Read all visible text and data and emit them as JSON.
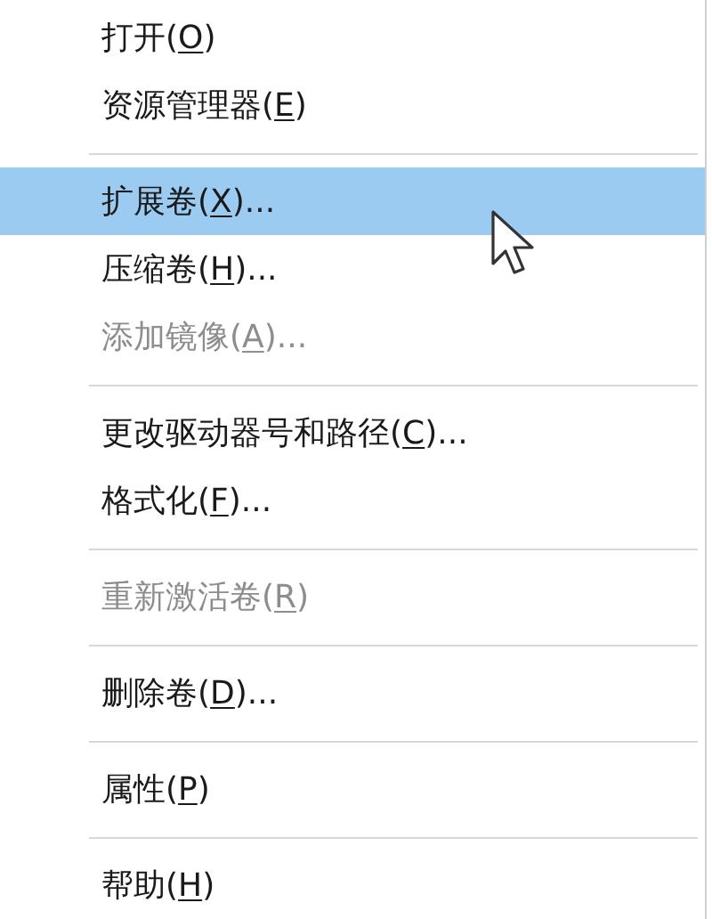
{
  "menu": {
    "items": [
      {
        "kind": "item",
        "before": "打开(",
        "key": "O",
        "after": ")",
        "selected": false,
        "disabled": false
      },
      {
        "kind": "item",
        "before": "资源管理器(",
        "key": "E",
        "after": ")",
        "selected": false,
        "disabled": false
      },
      {
        "kind": "separator"
      },
      {
        "kind": "item",
        "before": "扩展卷(",
        "key": "X",
        "after": ")...",
        "selected": true,
        "disabled": false
      },
      {
        "kind": "item",
        "before": "压缩卷(",
        "key": "H",
        "after": ")...",
        "selected": false,
        "disabled": false
      },
      {
        "kind": "item",
        "before": "添加镜像(",
        "key": "A",
        "after": ")...",
        "selected": false,
        "disabled": true
      },
      {
        "kind": "separator"
      },
      {
        "kind": "item",
        "before": "更改驱动器号和路径(",
        "key": "C",
        "after": ")...",
        "selected": false,
        "disabled": false
      },
      {
        "kind": "item",
        "before": "格式化(",
        "key": "F",
        "after": ")...",
        "selected": false,
        "disabled": false
      },
      {
        "kind": "separator"
      },
      {
        "kind": "item",
        "before": "重新激活卷(",
        "key": "R",
        "after": ")",
        "selected": false,
        "disabled": true
      },
      {
        "kind": "separator"
      },
      {
        "kind": "item",
        "before": "删除卷(",
        "key": "D",
        "after": ")...",
        "selected": false,
        "disabled": false
      },
      {
        "kind": "separator"
      },
      {
        "kind": "item",
        "before": "属性(",
        "key": "P",
        "after": ")",
        "selected": false,
        "disabled": false
      },
      {
        "kind": "separator"
      },
      {
        "kind": "item",
        "before": "帮助(",
        "key": "H",
        "after": ")",
        "selected": false,
        "disabled": false
      }
    ]
  }
}
